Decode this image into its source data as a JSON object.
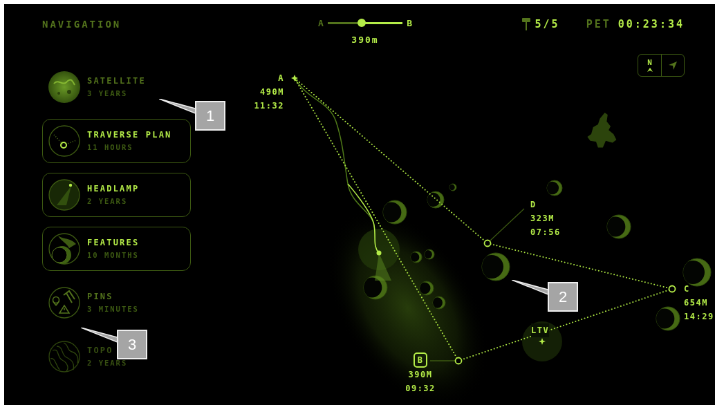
{
  "header": {
    "title": "NAVIGATION"
  },
  "progress": {
    "start": "A",
    "end": "B",
    "level": 0.45,
    "distance": "390m"
  },
  "pins": {
    "count": "5/5"
  },
  "pet": {
    "label": "PET",
    "time": "00:23:34"
  },
  "map_controls": [
    {
      "kind": "north",
      "label": "N"
    },
    {
      "kind": "locate"
    }
  ],
  "layers": [
    {
      "kind": "satellite",
      "title": "SATELLITE",
      "age": "3 YEARS",
      "on": false,
      "disabled": false
    },
    {
      "kind": "traverse",
      "title": "TRAVERSE PLAN",
      "age": "11 HOURS",
      "on": true,
      "disabled": false
    },
    {
      "kind": "headlamp",
      "title": "HEADLAMP",
      "age": "2 YEARS",
      "on": true,
      "disabled": false
    },
    {
      "kind": "features",
      "title": "FEATURES",
      "age": "10 MONTHS",
      "on": true,
      "disabled": false
    },
    {
      "kind": "pins",
      "title": "PINS",
      "age": "3 MINUTES",
      "on": false,
      "disabled": false
    },
    {
      "kind": "topo",
      "title": "TOPO",
      "age": "2 YEARS",
      "on": false,
      "disabled": true
    }
  ],
  "waypoints": [
    {
      "kind": "start",
      "name": "A",
      "distance": "490M",
      "time": "11:32"
    },
    {
      "kind": "via",
      "name": "D",
      "distance": "323M",
      "time": "07:56"
    },
    {
      "kind": "via",
      "name": "C",
      "distance": "654M",
      "time": "14:29"
    },
    {
      "kind": "target",
      "name": "B",
      "distance": "390M",
      "time": "09:32"
    }
  ],
  "rover": {
    "label": "LTV"
  },
  "callouts": [
    "1",
    "2",
    "3"
  ]
}
